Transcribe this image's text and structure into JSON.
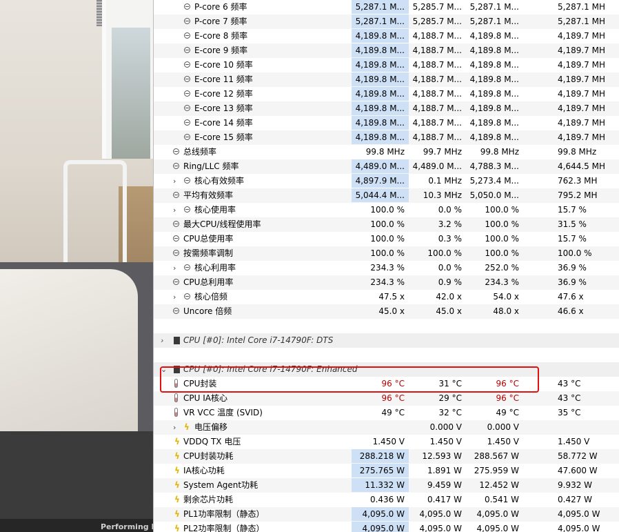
{
  "background": {
    "caption": "Performing R"
  },
  "rows": [
    {
      "name": "P-core 6 频率",
      "v1": "5,287.1 M...",
      "v2": "5,285.7 M...",
      "v3": "5,287.1 M...",
      "v4": "5,287.1 MH"
    },
    {
      "name": "P-core 7 频率",
      "v1": "5,287.1 M...",
      "v2": "5,285.7 M...",
      "v3": "5,287.1 M...",
      "v4": "5,287.1 MH"
    },
    {
      "name": "E-core 8 频率",
      "v1": "4,189.8 M...",
      "v2": "4,188.7 M...",
      "v3": "4,189.8 M...",
      "v4": "4,189.7 MH"
    },
    {
      "name": "E-core 9 频率",
      "v1": "4,189.8 M...",
      "v2": "4,188.7 M...",
      "v3": "4,189.8 M...",
      "v4": "4,189.7 MH"
    },
    {
      "name": "E-core 10 频率",
      "v1": "4,189.8 M...",
      "v2": "4,188.7 M...",
      "v3": "4,189.8 M...",
      "v4": "4,189.7 MH"
    },
    {
      "name": "E-core 11 频率",
      "v1": "4,189.8 M...",
      "v2": "4,188.7 M...",
      "v3": "4,189.8 M...",
      "v4": "4,189.7 MH"
    },
    {
      "name": "E-core 12 频率",
      "v1": "4,189.8 M...",
      "v2": "4,188.7 M...",
      "v3": "4,189.8 M...",
      "v4": "4,189.7 MH"
    },
    {
      "name": "E-core 13 频率",
      "v1": "4,189.8 M...",
      "v2": "4,188.7 M...",
      "v3": "4,189.8 M...",
      "v4": "4,189.7 MH"
    },
    {
      "name": "E-core 14 频率",
      "v1": "4,189.8 M...",
      "v2": "4,188.7 M...",
      "v3": "4,189.8 M...",
      "v4": "4,189.7 MH"
    },
    {
      "name": "E-core 15 频率",
      "v1": "4,189.8 M...",
      "v2": "4,188.7 M...",
      "v3": "4,189.8 M...",
      "v4": "4,189.7 MH"
    },
    {
      "name": "总线频率",
      "v1": "99.8 MHz",
      "v2": "99.7 MHz",
      "v3": "99.8 MHz",
      "v4": "99.8 MHz"
    },
    {
      "name": "Ring/LLC 频率",
      "v1": "4,489.0 M...",
      "v2": "4,489.0 M...",
      "v3": "4,788.3 M...",
      "v4": "4,644.5 MH"
    },
    {
      "name": "核心有效频率",
      "v1": "4,897.9 M...",
      "v2": "0.1 MHz",
      "v3": "5,273.4 M...",
      "v4": "762.3 MH"
    },
    {
      "name": "平均有效频率",
      "v1": "5,044.4 M...",
      "v2": "10.3 MHz",
      "v3": "5,050.0 M...",
      "v4": "795.2 MH"
    },
    {
      "name": "核心使用率",
      "v1": "100.0 %",
      "v2": "0.0 %",
      "v3": "100.0 %",
      "v4": "15.7 %"
    },
    {
      "name": "最大CPU/线程使用率",
      "v1": "100.0 %",
      "v2": "3.2 %",
      "v3": "100.0 %",
      "v4": "31.5 %"
    },
    {
      "name": "CPU总使用率",
      "v1": "100.0 %",
      "v2": "0.3 %",
      "v3": "100.0 %",
      "v4": "15.7 %"
    },
    {
      "name": "按需频率调制",
      "v1": "100.0 %",
      "v2": "100.0 %",
      "v3": "100.0 %",
      "v4": "100.0 %"
    },
    {
      "name": "核心利用率",
      "v1": "234.3 %",
      "v2": "0.0 %",
      "v3": "252.0 %",
      "v4": "36.9 %"
    },
    {
      "name": "CPU总利用率",
      "v1": "234.3 %",
      "v2": "0.9 %",
      "v3": "234.3 %",
      "v4": "36.9 %"
    },
    {
      "name": "核心倍频",
      "v1": "47.5 x",
      "v2": "42.0 x",
      "v3": "54.0 x",
      "v4": "47.6 x"
    },
    {
      "name": "Uncore 倍频",
      "v1": "45.0 x",
      "v2": "45.0 x",
      "v3": "48.0 x",
      "v4": "46.6 x"
    }
  ],
  "group_dts": "CPU [#0]: Intel Core i7-14790F: DTS",
  "group_enhanced": "CPU [#0]: Intel Core i7-14790F: Enhanced",
  "rows2": [
    {
      "name": "CPU封装",
      "v1": "96 °C",
      "v2": "31 °C",
      "v3": "96 °C",
      "v4": "43 °C"
    },
    {
      "name": "CPU IA核心",
      "v1": "96 °C",
      "v2": "29 °C",
      "v3": "96 °C",
      "v4": "43 °C"
    },
    {
      "name": "VR VCC 温度 (SVID)",
      "v1": "49 °C",
      "v2": "32 °C",
      "v3": "49 °C",
      "v4": "35 °C"
    },
    {
      "name": "电压偏移",
      "v1": "",
      "v2": "0.000 V",
      "v3": "0.000 V",
      "v4": ""
    },
    {
      "name": "VDDQ TX 电压",
      "v1": "1.450 V",
      "v2": "1.450 V",
      "v3": "1.450 V",
      "v4": "1.450 V"
    },
    {
      "name": "CPU封装功耗",
      "v1": "288.218 W",
      "v2": "12.593 W",
      "v3": "288.567 W",
      "v4": "58.772 W"
    },
    {
      "name": "IA核心功耗",
      "v1": "275.765 W",
      "v2": "1.891 W",
      "v3": "275.959 W",
      "v4": "47.600 W"
    },
    {
      "name": "System Agent功耗",
      "v1": "11.332 W",
      "v2": "9.459 W",
      "v3": "12.452 W",
      "v4": "9.932 W"
    },
    {
      "name": "剩余芯片功耗",
      "v1": "0.436 W",
      "v2": "0.417 W",
      "v3": "0.541 W",
      "v4": "0.427 W"
    },
    {
      "name": "PL1功率限制（静态）",
      "v1": "4,095.0 W",
      "v2": "4,095.0 W",
      "v3": "4,095.0 W",
      "v4": "4,095.0 W"
    },
    {
      "name": "PL2功率限制（静态）",
      "v1": "4,095.0 W",
      "v2": "4,095.0 W",
      "v3": "4,095.0 W",
      "v4": "4,095.0 W"
    }
  ]
}
